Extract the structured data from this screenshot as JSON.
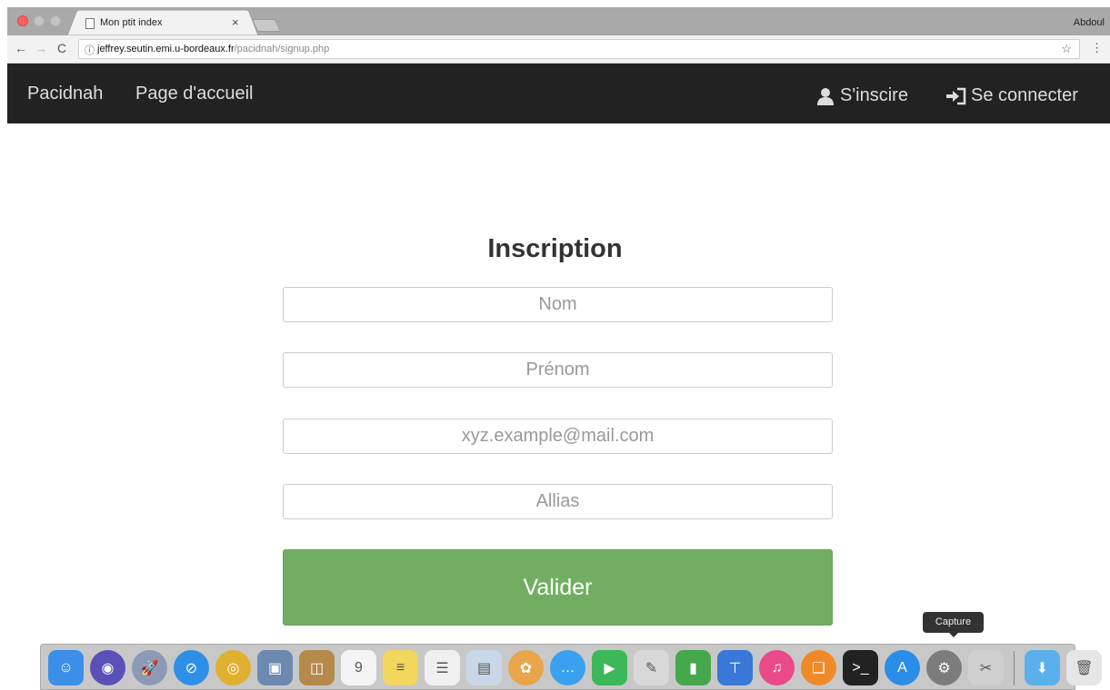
{
  "browser": {
    "tab_title": "Mon ptit index",
    "tab_close": "×",
    "profile_name": "Abdoul",
    "url_host": "jeffrey.seutin.emi.u-bordeaux.fr",
    "url_path": "/pacidnah/signup.php",
    "nav": {
      "back": "←",
      "forward": "→",
      "reload": "C"
    },
    "info_glyph": "ⓘ",
    "star_glyph": "☆",
    "menu_glyph": "⋮"
  },
  "navbar": {
    "brand": "Pacidnah",
    "home": "Page d'accueil",
    "signup": "S'inscire",
    "login": "Se connecter"
  },
  "form": {
    "title": "Inscription",
    "nom_placeholder": "Nom",
    "prenom_placeholder": "Prénom",
    "email_placeholder": "xyz.example@mail.com",
    "alias_placeholder": "Allias",
    "submit": "Valider"
  },
  "dock": {
    "tooltip": "Capture",
    "apps": [
      {
        "name": "finder",
        "color": "#3b8fe8",
        "glyph": "☺"
      },
      {
        "name": "siri",
        "color": "#5b4fb8",
        "glyph": "◉"
      },
      {
        "name": "launchpad",
        "color": "#8c9bb5",
        "glyph": "🚀"
      },
      {
        "name": "safari",
        "color": "#2e8fe6",
        "glyph": "⊘"
      },
      {
        "name": "chrome",
        "color": "#e0b030",
        "glyph": "◎"
      },
      {
        "name": "preview",
        "color": "#6c8ab0",
        "glyph": "▣"
      },
      {
        "name": "contacts",
        "color": "#b58a4a",
        "glyph": "◫"
      },
      {
        "name": "calendar",
        "color": "#f4f4f4",
        "glyph": "9"
      },
      {
        "name": "notes",
        "color": "#f3d65c",
        "glyph": "≡"
      },
      {
        "name": "reminders",
        "color": "#f0f0f0",
        "glyph": "☰"
      },
      {
        "name": "photo-booth",
        "color": "#c8d8e8",
        "glyph": "▤"
      },
      {
        "name": "photos",
        "color": "#e8a54a",
        "glyph": "✿"
      },
      {
        "name": "messages",
        "color": "#3aa0f0",
        "glyph": "…"
      },
      {
        "name": "facetime",
        "color": "#3cb85a",
        "glyph": "▶"
      },
      {
        "name": "textedit",
        "color": "#d8d8d8",
        "glyph": "✎"
      },
      {
        "name": "numbers",
        "color": "#46a84c",
        "glyph": "▮"
      },
      {
        "name": "keynote",
        "color": "#3978d8",
        "glyph": "⊤"
      },
      {
        "name": "itunes",
        "color": "#e84a8a",
        "glyph": "♫"
      },
      {
        "name": "ibooks",
        "color": "#f08a28",
        "glyph": "❑"
      },
      {
        "name": "terminal",
        "color": "#222222",
        "glyph": ">_"
      },
      {
        "name": "app-store",
        "color": "#2a8ee8",
        "glyph": "A"
      },
      {
        "name": "system-preferences",
        "color": "#7c7c7c",
        "glyph": "⚙"
      },
      {
        "name": "screenshot",
        "color": "#cfcfcf",
        "glyph": "✂"
      }
    ],
    "trailing": [
      {
        "name": "downloads-folder",
        "color": "#5ab0ea",
        "glyph": "⬇"
      },
      {
        "name": "trash",
        "color": "#e6e6e6",
        "glyph": "🗑"
      }
    ]
  }
}
